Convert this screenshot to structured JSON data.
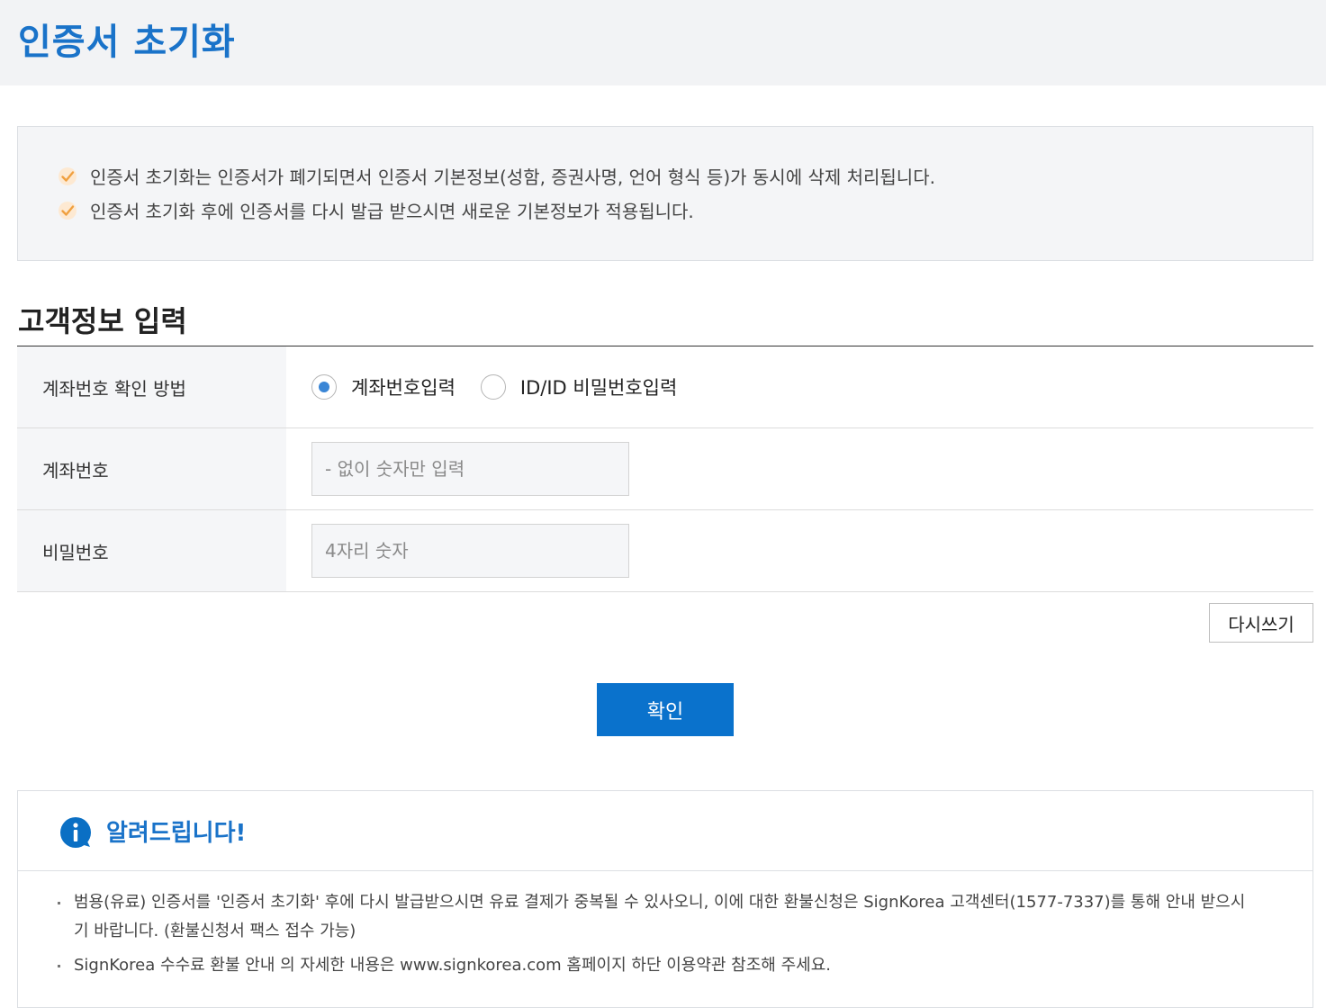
{
  "header": {
    "title": "인증서 초기화"
  },
  "notice": {
    "items": [
      "인증서 초기화는 인증서가 폐기되면서 인증서 기본정보(성함, 증권사명, 언어 형식 등)가 동시에 삭제 처리됩니다.",
      "인증서 초기화 후에 인증서를 다시 발급 받으시면 새로운 기본정보가 적용됩니다."
    ]
  },
  "form": {
    "section_title": "고객정보 입력",
    "method": {
      "label": "계좌번호 확인 방법",
      "options": [
        "계좌번호입력",
        "ID/ID 비밀번호입력"
      ],
      "selected": "계좌번호입력"
    },
    "account": {
      "label": "계좌번호",
      "value": "",
      "placeholder": "- 없이 숫자만 입력"
    },
    "password": {
      "label": "비밀번호",
      "value": "",
      "placeholder": "4자리 숫자"
    },
    "reset_label": "다시쓰기",
    "confirm_label": "확인"
  },
  "info": {
    "title": "알려드립니다!",
    "items": [
      "범용(유료) 인증서를 '인증서 초기화' 후에 다시 발급받으시면 유료 결제가 중복될 수 있사오니, 이에 대한 환불신청은 SignKorea 고객센터(1577-7337)를 통해 안내 받으시기 바랍니다. (환불신청서 팩스 접수 가능)",
      "SignKorea 수수료 환불 안내 의 자세한 내용은 www.signkorea.com 홈페이지 하단 이용약관 참조해 주세요."
    ]
  },
  "colors": {
    "accent": "#1a73c9",
    "button": "#0a72cc",
    "check": "#f0a040",
    "radio_selected": "#3a86d6"
  },
  "icons": {
    "notice_check": "check-icon",
    "info": "info-icon"
  }
}
